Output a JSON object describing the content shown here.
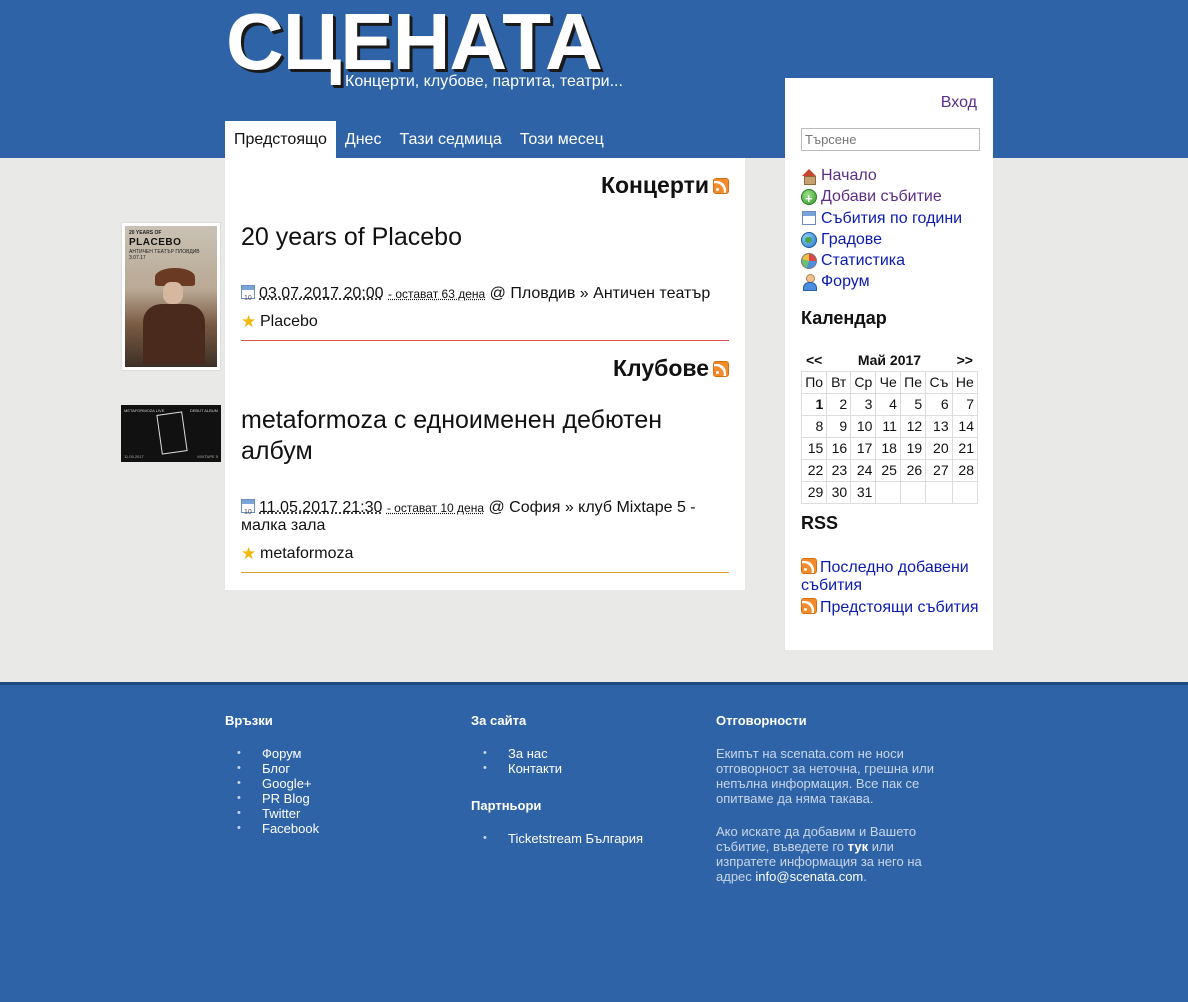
{
  "site": {
    "logo": "СЦЕНАТА",
    "tagline": "Концерти, клубове, партита, театри..."
  },
  "nav": {
    "tabs": [
      "Предстоящо",
      "Днес",
      "Тази седмица",
      "Този месец"
    ]
  },
  "sections": [
    {
      "heading": "Концерти",
      "event": {
        "title": "20 years of Placebo",
        "date": "03.07.2017 20:00",
        "remaining": "- остават 63 дена",
        "location": "@ Пловдив » Античен театър",
        "artist": "Placebo",
        "thumb_text": {
          "t1": "20 YEARS OF",
          "t2": "PLACEBO",
          "t3": "АНТИЧЕН ТЕАТЪР ПЛОВДИВ 3.07.17"
        }
      }
    },
    {
      "heading": "Клубове",
      "event": {
        "title": "metaformoza с едноименен дебютен албум",
        "date": "11.05.2017 21:30",
        "remaining": "- остават 10 дена",
        "location": "@ София » клуб Mixtape 5 - малка зала",
        "artist": "metaformoza",
        "thumb_text": {
          "t1": "METAFORMOZA LIVE",
          "t2": "DEBUT ALBUM",
          "t3": "11.05.2017",
          "t4": "MIXTAPE 5"
        }
      }
    }
  ],
  "sidebar": {
    "login": "Вход",
    "search_placeholder": "Търсене",
    "menu": [
      {
        "label": "Начало",
        "icon": "home-icon"
      },
      {
        "label": "Добави събитие",
        "icon": "add-icon"
      },
      {
        "label": "Събития по години",
        "icon": "calendar-icon"
      },
      {
        "label": "Градове",
        "icon": "globe-icon"
      },
      {
        "label": "Статистика",
        "icon": "pie-chart-icon"
      },
      {
        "label": "Форум",
        "icon": "users-icon"
      }
    ],
    "calendar_heading": "Календар",
    "calendar": {
      "prev": "<<",
      "month": "Май 2017",
      "next": ">>",
      "weekdays": [
        "По",
        "Вт",
        "Ср",
        "Че",
        "Пе",
        "Съ",
        "Не"
      ],
      "weeks": [
        [
          "1",
          "2",
          "3",
          "4",
          "5",
          "6",
          "7"
        ],
        [
          "8",
          "9",
          "10",
          "11",
          "12",
          "13",
          "14"
        ],
        [
          "15",
          "16",
          "17",
          "18",
          "19",
          "20",
          "21"
        ],
        [
          "22",
          "23",
          "24",
          "25",
          "26",
          "27",
          "28"
        ],
        [
          "29",
          "30",
          "31",
          "",
          "",
          "",
          ""
        ]
      ],
      "today": "1"
    },
    "rss_heading": "RSS",
    "rss_links": [
      "Последно добавени събития",
      "Предстоящи събития"
    ]
  },
  "footer": {
    "links_heading": "Връзки",
    "links": [
      "Форум",
      "Блог",
      "Google+",
      "PR Blog",
      "Twitter",
      "Facebook"
    ],
    "about_heading": "За сайта",
    "about": [
      "За нас",
      "Контакти"
    ],
    "partners_heading": "Партньори",
    "partners": [
      "Ticketstream България"
    ],
    "disclaimer_heading": "Отговорности",
    "disclaimer_p1": "Екипът на scenata.com не носи отговорност за неточна, грешна или непълна информация. Все пак се опитваме да няма такава.",
    "disclaimer_p2_a": "Ако искате да добавим и Вашето събитие, въведете го",
    "disclaimer_p2_link": "тук",
    "disclaimer_p2_b": "или изпратете информация за него на адрес",
    "disclaimer_email": "info@scenata.com",
    "disclaimer_end": "."
  },
  "colors": {
    "header_blue": "#2e64a7",
    "page_bg": "#e9eae7",
    "link_blue": "#0b1bb0",
    "visited_purple": "#5b2d87",
    "concerts_separator": "#d9534f",
    "clubs_separator": "#e0a030"
  }
}
